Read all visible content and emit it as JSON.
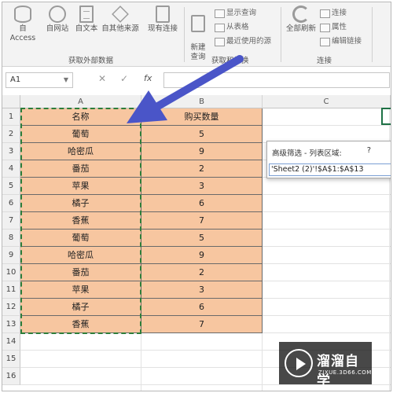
{
  "ribbon": {
    "buttons": [
      {
        "label": "自 Access",
        "icon": "database-icon"
      },
      {
        "label": "自网站",
        "icon": "globe-icon"
      },
      {
        "label": "自文本",
        "icon": "text-file-icon"
      },
      {
        "label": "自其他来源",
        "icon": "other-sources-icon"
      },
      {
        "label": "现有连接",
        "icon": "existing-connections-icon"
      },
      {
        "label": "新建\n查询",
        "icon": "new-query-icon"
      },
      {
        "label": "全部刷新",
        "icon": "refresh-icon"
      }
    ],
    "small_items": [
      {
        "label": "显示查询",
        "icon": "show-queries-icon"
      },
      {
        "label": "从表格",
        "icon": "from-table-icon"
      },
      {
        "label": "最近使用的源",
        "icon": "recent-sources-icon"
      },
      {
        "label": "连接",
        "icon": "connections-icon"
      },
      {
        "label": "属性",
        "icon": "properties-icon"
      },
      {
        "label": "编辑链接",
        "icon": "edit-links-icon"
      }
    ],
    "groups": [
      "获取外部数据",
      "获取和转换",
      "连接"
    ]
  },
  "formula_bar": {
    "name_box": "A1",
    "cancel_icon": "✕",
    "enter_icon": "✓",
    "fx_label": "fx",
    "formula": ""
  },
  "columns": [
    "A",
    "B",
    "C"
  ],
  "rows": [
    "1",
    "2",
    "3",
    "4",
    "5",
    "6",
    "7",
    "8",
    "9",
    "10",
    "11",
    "12",
    "13",
    "14",
    "15",
    "16"
  ],
  "table": {
    "headers": [
      "名称",
      "购买数量"
    ],
    "data": [
      [
        "葡萄",
        "5"
      ],
      [
        "哈密瓜",
        "9"
      ],
      [
        "番茄",
        "2"
      ],
      [
        "苹果",
        "3"
      ],
      [
        "橘子",
        "6"
      ],
      [
        "香蕉",
        "7"
      ],
      [
        "葡萄",
        "5"
      ],
      [
        "哈密瓜",
        "9"
      ],
      [
        "番茄",
        "2"
      ],
      [
        "苹果",
        "3"
      ],
      [
        "橘子",
        "6"
      ],
      [
        "香蕉",
        "7"
      ]
    ]
  },
  "dialog": {
    "title": "高级筛选 - 列表区域:",
    "help": "?",
    "value": "'Sheet2 (2)'!$A$1:$A$13"
  },
  "watermark": {
    "name": "溜溜自学",
    "url": "ZIXUE.3D66.COM"
  },
  "colors": {
    "cell_fill": "#f7c6a0",
    "selection": "#2d7d3a",
    "arrow": "#4a55c8"
  }
}
